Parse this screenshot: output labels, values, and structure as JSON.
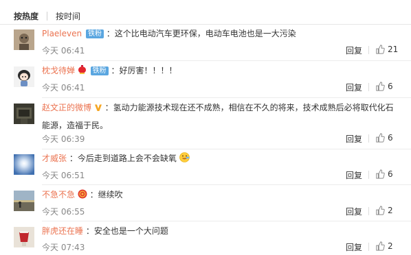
{
  "sort": {
    "hot": "按热度",
    "time": "按时间"
  },
  "reply_label": "回复",
  "comments": [
    {
      "user": "Plaeleven",
      "badge": "铁粉",
      "text": "：这个比电动汽车更环保，电动车电池也是一大污染",
      "time": "今天 06:41",
      "likes": "21"
    },
    {
      "user": "枕戈待婵",
      "badge": "铁粉",
      "text": "：好厉害！！！！",
      "time": "今天 06:41",
      "likes": "6"
    },
    {
      "user": "赵文正的微博",
      "text": "：氢动力能源技术现在还不成熟，相信在不久的将来，技术成熟后必将取代化石能源，造福于民。",
      "time": "今天 06:39",
      "likes": "6"
    },
    {
      "user": "才威张",
      "text": "：今后走到道路上会不会缺氧",
      "time": "今天 06:51",
      "likes": "6"
    },
    {
      "user": "不急不急",
      "text": "：继续吹",
      "time": "今天 06:55",
      "likes": "2"
    },
    {
      "user": "胖虎还在睡",
      "text": "：安全也是一个大问题",
      "time": "今天 07:43",
      "likes": "2"
    }
  ],
  "icons": [
    "thumbs-up-icon",
    "verified-v-icon",
    "smiley-emoji-icon",
    "lantern-icon"
  ],
  "colors": {
    "username": "#eb7350",
    "badge": "#5aa6e0",
    "time": "#888888",
    "verified": "#f5a623"
  }
}
